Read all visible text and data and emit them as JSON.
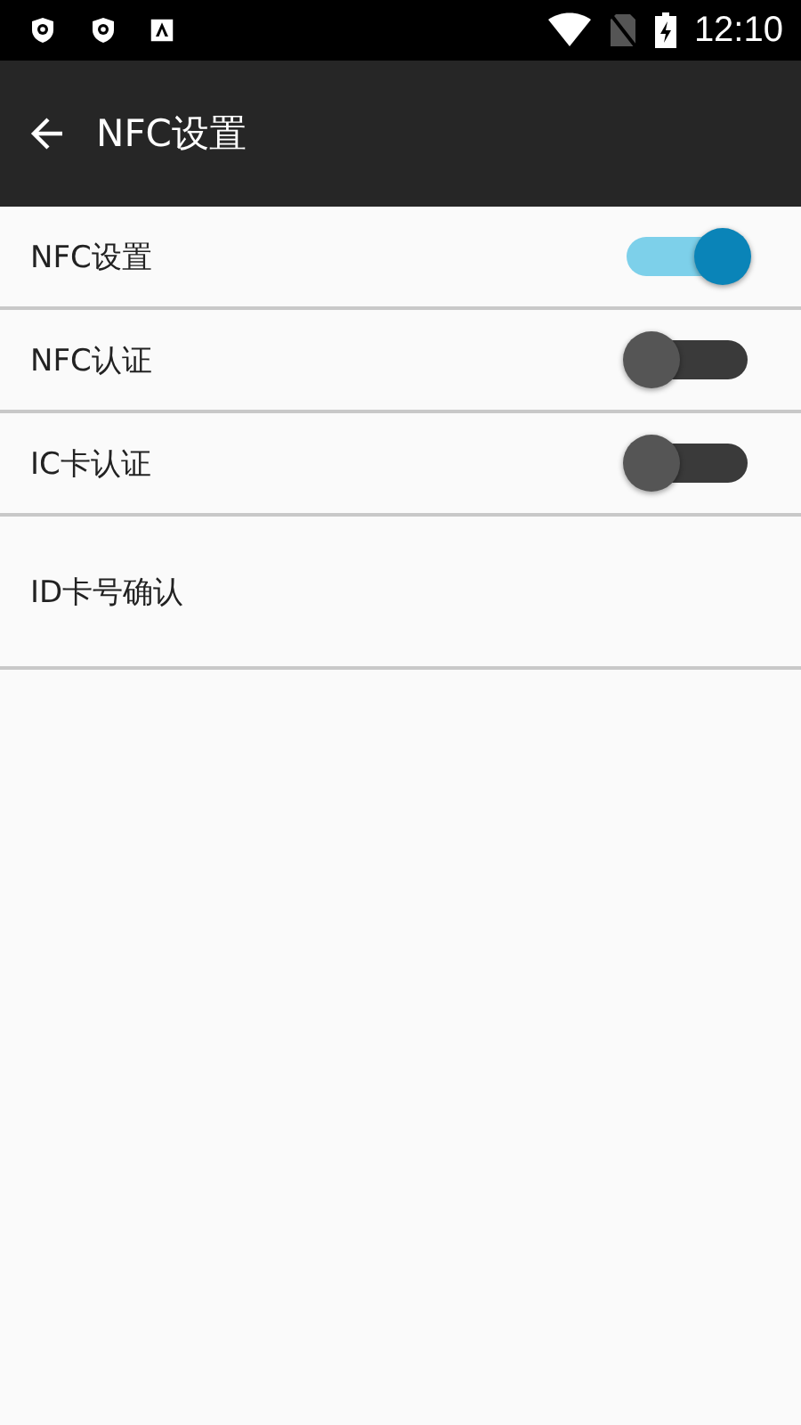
{
  "status_bar": {
    "time": "12:10"
  },
  "app_bar": {
    "title": "NFC设置"
  },
  "items": [
    {
      "kind": "switch",
      "label": "NFC设置",
      "on": true
    },
    {
      "kind": "switch",
      "label": "NFC认证",
      "on": false
    },
    {
      "kind": "switch",
      "label": "IC卡认证",
      "on": false
    },
    {
      "kind": "link",
      "label": "ID卡号确认"
    }
  ]
}
